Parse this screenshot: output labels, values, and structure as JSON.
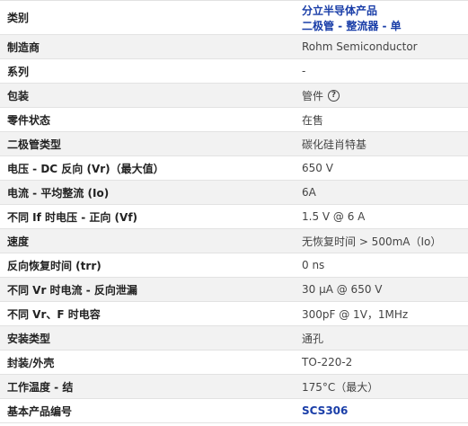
{
  "rows": [
    {
      "label": "类别",
      "value_lines": [
        "分立半导体产品",
        "二极管 - 整流器 - 单"
      ],
      "link": true
    },
    {
      "label": "制造商",
      "value": "Rohm Semiconductor"
    },
    {
      "label": "系列",
      "value": "-"
    },
    {
      "label": "包装",
      "value": "管件",
      "help_icon": "question-circle-icon"
    },
    {
      "label": "零件状态",
      "value": "在售"
    },
    {
      "label": "二极管类型",
      "value": "碳化硅肖特基"
    },
    {
      "label": "电压 - DC 反向 (Vr)（最大值）",
      "value": "650 V"
    },
    {
      "label": "电流 - 平均整流 (Io)",
      "value": "6A"
    },
    {
      "label": "不同 If 时电压 - 正向 (Vf)",
      "value": "1.5 V @ 6 A"
    },
    {
      "label": "速度",
      "value": "无恢复时间 > 500mA（Io）"
    },
    {
      "label": "反向恢复时间 (trr)",
      "value": "0 ns"
    },
    {
      "label": "不同 Vr 时电流 - 反向泄漏",
      "value": "30 µA @ 650 V"
    },
    {
      "label": "不同 Vr、F 时电容",
      "value": "300pF @ 1V，1MHz"
    },
    {
      "label": "安装类型",
      "value": "通孔"
    },
    {
      "label": "封装/外壳",
      "value": "TO-220-2"
    },
    {
      "label": "工作温度 - 结",
      "value": "175°C（最大）"
    },
    {
      "label": "基本产品编号",
      "value": "SCS306",
      "link": true
    }
  ],
  "colors": {
    "link": "#1a3ea8",
    "row_even": "#f2f2f2",
    "row_odd": "#ffffff",
    "border": "#e2e2e2"
  }
}
